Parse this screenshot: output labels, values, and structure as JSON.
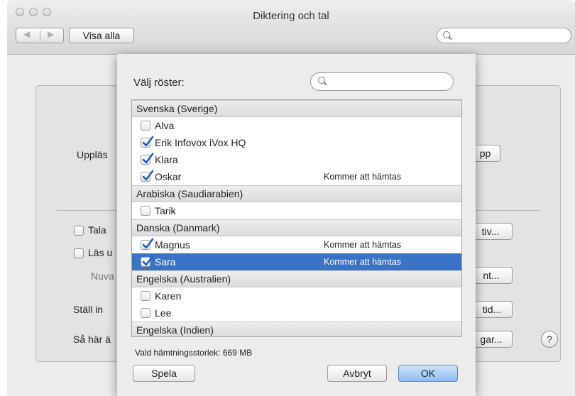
{
  "window": {
    "title": "Diktering och tal",
    "show_all_label": "Visa alla",
    "nav_back_glyph": "◀",
    "nav_forward_glyph": "▶"
  },
  "background": {
    "label_upplasning": "Uppläs",
    "stop_button_tail": "pp",
    "check1_label": "Tala",
    "check1_button_tail": "tiv...",
    "check2_label": "Läs u",
    "now_label": "Nuva",
    "now_button_tail": "nt...",
    "set_label": "Ställ in",
    "set_button_tail": "tid...",
    "how_label": "Så här ä",
    "how_button_tail": "gar...",
    "help_glyph": "?"
  },
  "sheet": {
    "label": "Välj röster:",
    "download_size": "Vald hämtningsstorlek: 669 MB",
    "play_label": "Spela",
    "cancel_label": "Avbryt",
    "ok_label": "OK",
    "groups": [
      {
        "name": "Svenska (Sverige)",
        "voices": [
          {
            "name": "Alva",
            "checked": false,
            "status": ""
          },
          {
            "name": "Erik Infovox iVox HQ",
            "checked": true,
            "status": ""
          },
          {
            "name": "Klara",
            "checked": true,
            "status": ""
          },
          {
            "name": "Oskar",
            "checked": true,
            "status": "Kommer att hämtas"
          }
        ]
      },
      {
        "name": "Arabiska (Saudiarabien)",
        "voices": [
          {
            "name": "Tarik",
            "checked": false,
            "status": ""
          }
        ]
      },
      {
        "name": "Danska (Danmark)",
        "voices": [
          {
            "name": "Magnus",
            "checked": true,
            "status": "Kommer att hämtas"
          },
          {
            "name": "Sara",
            "checked": true,
            "status": "Kommer att hämtas",
            "selected": true
          }
        ]
      },
      {
        "name": "Engelska (Australien)",
        "voices": [
          {
            "name": "Karen",
            "checked": false,
            "status": ""
          },
          {
            "name": "Lee",
            "checked": false,
            "status": ""
          }
        ]
      },
      {
        "name": "Engelska (Indien)",
        "voices": []
      }
    ]
  },
  "colors": {
    "selection": "#3a73c6",
    "checkmark": "#1f5fc4"
  }
}
